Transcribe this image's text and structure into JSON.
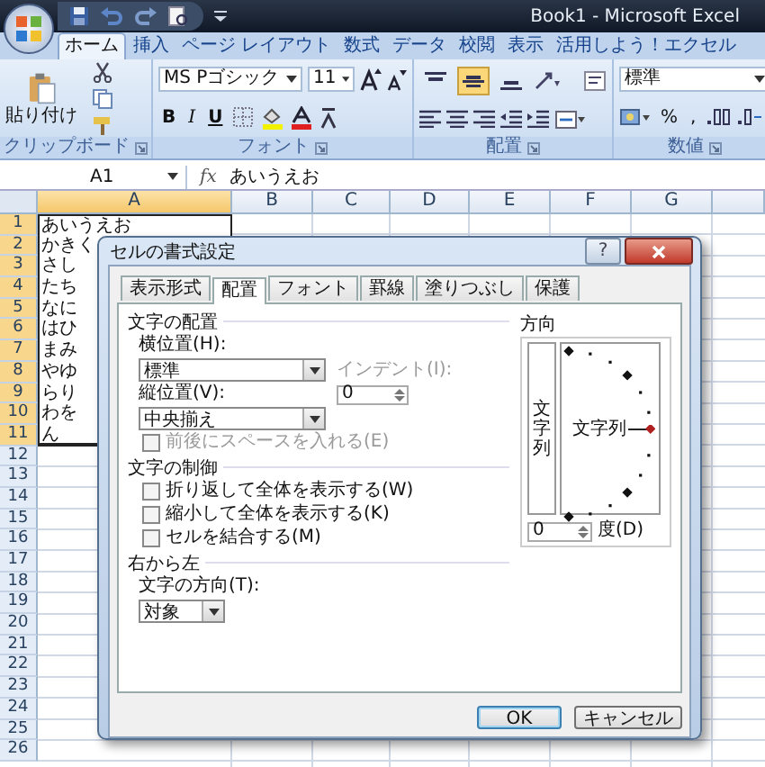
{
  "window": {
    "title": "Book1 - Microsoft Excel"
  },
  "ribbon_tabs": [
    {
      "label": "ホーム",
      "selected": true
    },
    {
      "label": "挿入",
      "selected": false
    },
    {
      "label": "ページ レイアウト",
      "selected": false
    },
    {
      "label": "数式",
      "selected": false
    },
    {
      "label": "データ",
      "selected": false
    },
    {
      "label": "校閲",
      "selected": false
    },
    {
      "label": "表示",
      "selected": false
    },
    {
      "label": "活用しよう！エクセル",
      "selected": false
    }
  ],
  "ribbon": {
    "clipboard": {
      "paste_label": "貼り付け",
      "group_label": "クリップボード"
    },
    "font": {
      "font_name": "MS Pゴシック",
      "font_size": "11",
      "bold": "B",
      "italic": "I",
      "underline": "U",
      "group_label": "フォント"
    },
    "alignment": {
      "vertical": [
        {
          "kind": "top",
          "selected": false
        },
        {
          "kind": "middle",
          "selected": true
        },
        {
          "kind": "bottom",
          "selected": false
        }
      ],
      "group_label": "配置"
    },
    "number": {
      "format": "標準",
      "percent": "%",
      "comma": ",",
      "group_label": "数値"
    }
  },
  "formula_bar": {
    "name_box": "A1",
    "fx": "fx",
    "value": "あいうえお"
  },
  "sheet": {
    "columns": [
      {
        "label": "A",
        "selected": true
      },
      {
        "label": "B",
        "selected": false
      },
      {
        "label": "C",
        "selected": false
      },
      {
        "label": "D",
        "selected": false
      },
      {
        "label": "E",
        "selected": false
      },
      {
        "label": "F",
        "selected": false
      },
      {
        "label": "G",
        "selected": false
      }
    ],
    "rows": [
      {
        "number": "1",
        "selected": true,
        "cell": "あいうえお"
      },
      {
        "number": "2",
        "selected": true,
        "cell": "かきく"
      },
      {
        "number": "3",
        "selected": true,
        "cell": "さし"
      },
      {
        "number": "4",
        "selected": true,
        "cell": "たち"
      },
      {
        "number": "5",
        "selected": true,
        "cell": "なに"
      },
      {
        "number": "6",
        "selected": true,
        "cell": "はひ"
      },
      {
        "number": "7",
        "selected": true,
        "cell": "まみ"
      },
      {
        "number": "8",
        "selected": true,
        "cell": "やゆ"
      },
      {
        "number": "9",
        "selected": true,
        "cell": "らり"
      },
      {
        "number": "10",
        "selected": true,
        "cell": "わを"
      },
      {
        "number": "11",
        "selected": true,
        "cell": "ん"
      },
      {
        "number": "12",
        "selected": false
      },
      {
        "number": "13",
        "selected": false
      },
      {
        "number": "14",
        "selected": false
      },
      {
        "number": "15",
        "selected": false
      },
      {
        "number": "16",
        "selected": false
      },
      {
        "number": "17",
        "selected": false
      },
      {
        "number": "18",
        "selected": false
      },
      {
        "number": "19",
        "selected": false
      },
      {
        "number": "20",
        "selected": false
      },
      {
        "number": "21",
        "selected": false
      },
      {
        "number": "22",
        "selected": false
      },
      {
        "number": "23",
        "selected": false
      },
      {
        "number": "24",
        "selected": false
      },
      {
        "number": "25",
        "selected": false
      },
      {
        "number": "26",
        "selected": false
      }
    ]
  },
  "dialog": {
    "title": "セルの書式設定",
    "help": "?",
    "tabs": [
      {
        "label": "表示形式",
        "selected": false
      },
      {
        "label": "配置",
        "selected": true
      },
      {
        "label": "フォント",
        "selected": false
      },
      {
        "label": "罫線",
        "selected": false
      },
      {
        "label": "塗りつぶし",
        "selected": false
      },
      {
        "label": "保護",
        "selected": false
      }
    ],
    "text_alignment": {
      "label": "文字の配置",
      "horizontal_label": "横位置(H):",
      "horizontal_value": "標準",
      "vertical_label": "縦位置(V):",
      "vertical_value": "中央揃え",
      "indent": {
        "label": "インデント(I):",
        "value": "0",
        "disabled": true
      },
      "distributed": {
        "label": "前後にスペースを入れる(E)",
        "checked": false,
        "disabled": true
      }
    },
    "text_control": {
      "label": "文字の制御",
      "options": [
        {
          "label": "折り返して全体を表示する(W)",
          "checked": false,
          "disabled": false
        },
        {
          "label": "縮小して全体を表示する(K)",
          "checked": false,
          "disabled": false
        },
        {
          "label": "セルを結合する(M)",
          "checked": false,
          "disabled": false
        }
      ]
    },
    "right_to_left": {
      "label": "右から左",
      "direction_label": "文字の方向(T):",
      "direction_value": "対象"
    },
    "orientation": {
      "label": "方向",
      "vertical_text": "文字列",
      "dial_text": "文字列",
      "degrees": "0",
      "degrees_label": "度(D)"
    },
    "buttons": [
      {
        "label": "OK",
        "kind": "default"
      },
      {
        "label": "キャンセル",
        "kind": "normal"
      }
    ]
  }
}
